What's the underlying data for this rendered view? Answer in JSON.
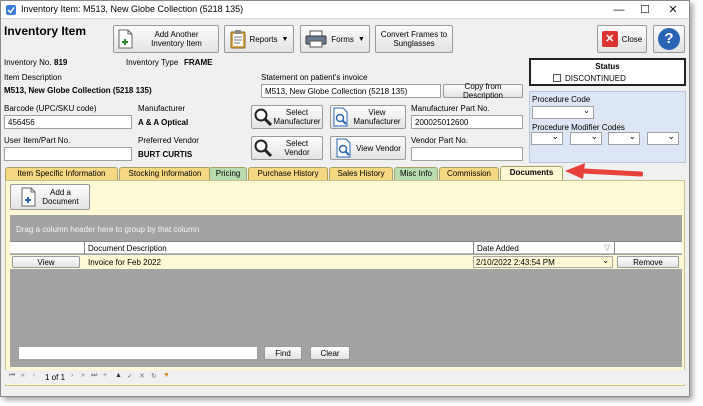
{
  "window": {
    "title": "Inventory Item:  M513, New Globe Collection (5218  135)",
    "minimize": "—",
    "maximize": "☐",
    "close": "✕"
  },
  "header": {
    "heading": "Inventory Item",
    "inventory_no_label": "Inventory No.",
    "inventory_no_value": "819",
    "inventory_type_label": "Inventory Type",
    "inventory_type_value": "FRAME",
    "item_description_label": "Item Description",
    "item_description_value": "M513, New Globe Collection (5218  135)",
    "statement_label": "Statement on patient's invoice",
    "statement_value": "M513, New Globe Collection (5218  135)",
    "barcode_label": "Barcode (UPC/SKU code)",
    "barcode_value": "456456",
    "manufacturer_label": "Manufacturer",
    "manufacturer_value": "A & A Optical",
    "mfr_part_label": "Manufacturer Part No.",
    "mfr_part_value": "200025012600",
    "user_item_label": "User Item/Part No.",
    "user_item_value": "",
    "preferred_vendor_label": "Preferred Vendor",
    "preferred_vendor_value": "BURT CURTIS",
    "vendor_part_label": "Vendor Part No.",
    "vendor_part_value": ""
  },
  "toolbar": {
    "add_another": "Add Another Inventory Item",
    "reports": "Reports",
    "forms": "Forms",
    "convert": "Convert Frames to Sunglasses",
    "close": "Close",
    "help": "?"
  },
  "buttons": {
    "copy_from_description": "Copy from Description",
    "select_manufacturer": "Select Manufacturer",
    "view_manufacturer": "View Manufacturer",
    "select_vendor": "Select Vendor",
    "view_vendor": "View Vendor"
  },
  "status": {
    "title": "Status",
    "discontinued": "DISCONTINUED"
  },
  "procedure": {
    "code_label": "Procedure Code",
    "modifier_label": "Procedure Modifier Codes"
  },
  "tabs": [
    {
      "label": "Item Specific Information"
    },
    {
      "label": "Stocking Information"
    },
    {
      "label": "Pricing"
    },
    {
      "label": "Purchase History"
    },
    {
      "label": "Sales History"
    },
    {
      "label": "Misc Info"
    },
    {
      "label": "Commission"
    },
    {
      "label": "Documents"
    }
  ],
  "documents": {
    "add_document": "Add a Document",
    "group_hint": "Drag a column header here to group by that column",
    "col_description": "Document Description",
    "col_date": "Date Added",
    "rows": [
      {
        "view": "View",
        "description": "Invoice for Feb 2022",
        "date": "2/10/2022 2:43:54 PM",
        "remove": "Remove"
      }
    ],
    "find": "Find",
    "clear": "Clear",
    "search_value": ""
  },
  "pager": {
    "text": "1 of 1"
  },
  "colors": {
    "arrow": "#e8403a",
    "active_tab": "#fdf9d4",
    "tab_yellow": "#f6d882",
    "tab_green": "#b8dcb0",
    "grid_gray": "#a3a3a3"
  }
}
